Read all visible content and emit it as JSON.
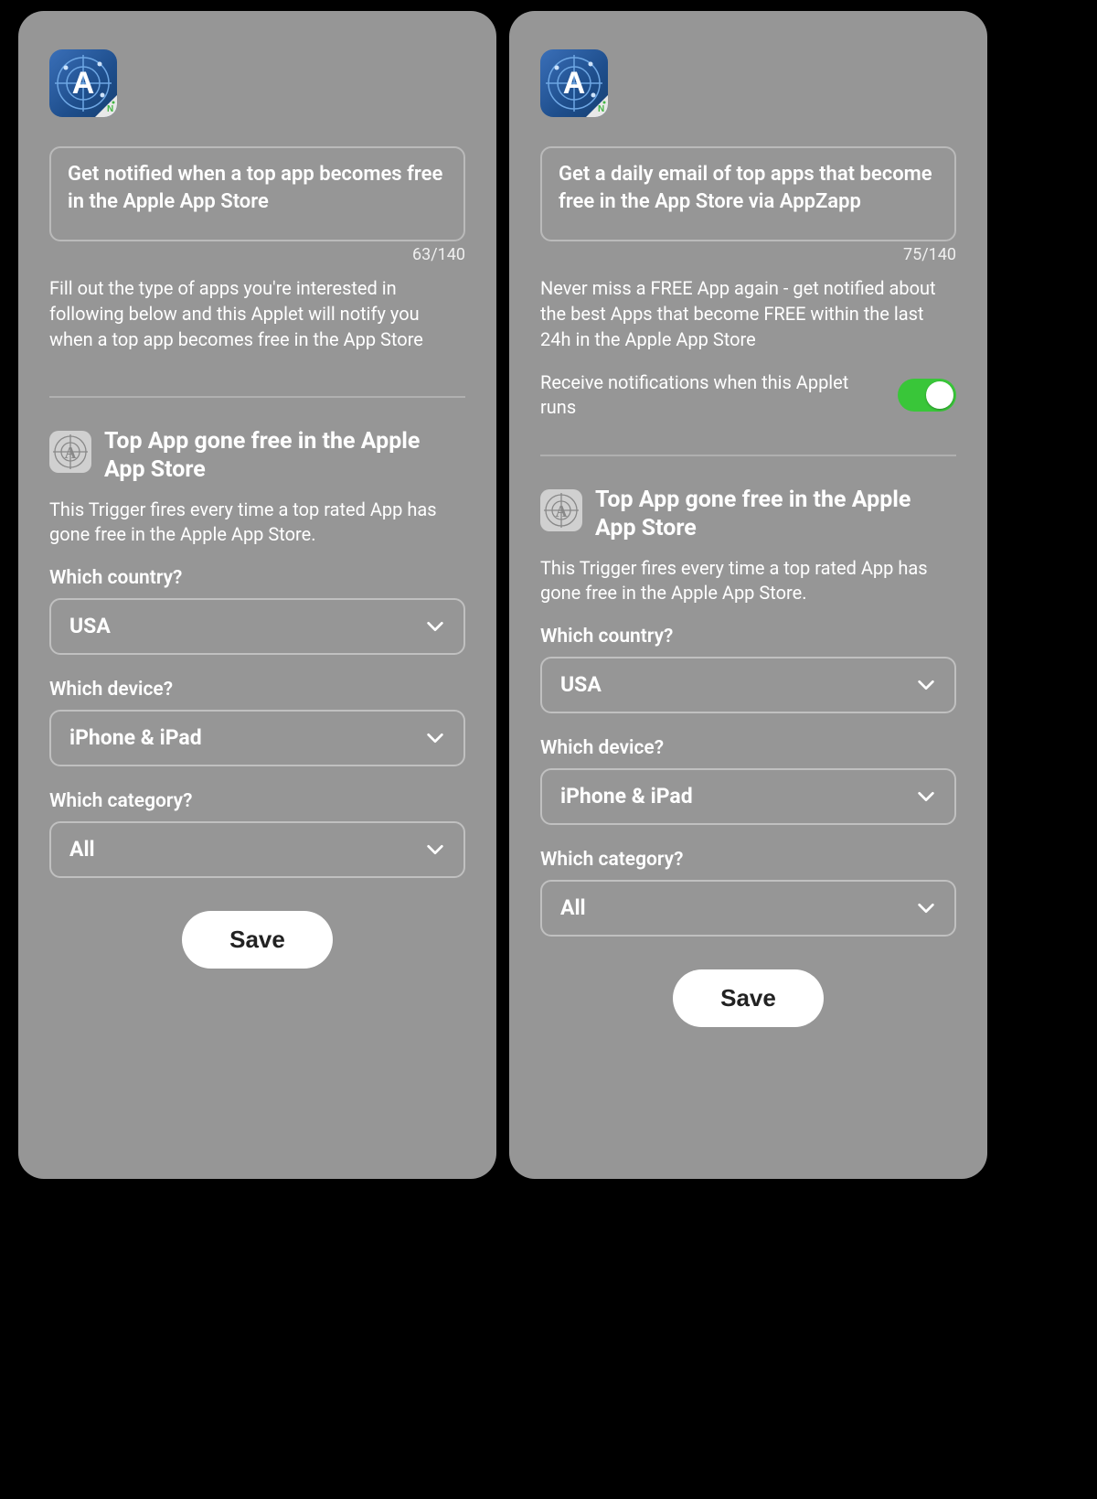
{
  "left": {
    "title": "Get notified when a top app becomes free in the Apple App Store",
    "char_count": "63/140",
    "description": "Fill out the type of apps you're interested in following below and this Applet will notify you when a top app becomes free in the App Store",
    "trigger": {
      "title": "Top App gone free in the Apple App Store",
      "desc": "This Trigger fires every time a top rated App has gone free in the Apple App Store."
    },
    "fields": {
      "country_label": "Which country?",
      "country_value": "USA",
      "device_label": "Which device?",
      "device_value": "iPhone & iPad",
      "category_label": "Which category?",
      "category_value": "All"
    },
    "save_label": "Save"
  },
  "right": {
    "title": "Get a daily email of top apps that become free in the App Store via AppZapp",
    "char_count": "75/140",
    "description": "Never miss a FREE App again - get notified about the best Apps that become FREE within the last 24h in the Apple App Store",
    "toggle_label": "Receive notifications when this Applet runs",
    "toggle_on": true,
    "trigger": {
      "title": "Top App gone free in the Apple App Store",
      "desc": "This Trigger fires every time a top rated App has gone free in the Apple App Store."
    },
    "fields": {
      "country_label": "Which country?",
      "country_value": "USA",
      "device_label": "Which device?",
      "device_value": "iPhone & iPad",
      "category_label": "Which category?",
      "category_value": "All"
    },
    "save_label": "Save"
  }
}
